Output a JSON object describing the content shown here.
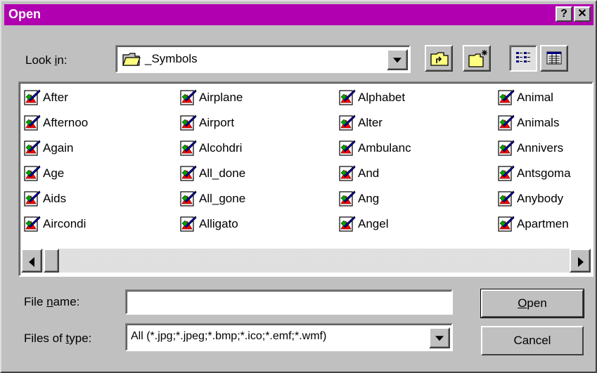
{
  "window": {
    "title": "Open",
    "help_label": "?",
    "close_label": "✕"
  },
  "lookin": {
    "label_pre": "Look ",
    "label_key": "i",
    "label_post": "n:",
    "value": "_Symbols"
  },
  "files": [
    [
      "After",
      "Afternoo",
      "Again",
      "Age",
      "Aids",
      "Aircondi"
    ],
    [
      "Airplane",
      "Airport",
      "Alcohdri",
      "All_done",
      "All_gone",
      "Alligato"
    ],
    [
      "Alphabet",
      "Alter",
      "Ambulanc",
      "And",
      "Ang",
      "Angel"
    ],
    [
      "Animal",
      "Animals",
      "Annivers",
      "Antsgoma",
      "Anybody",
      "Apartmen"
    ]
  ],
  "filename": {
    "label_pre": "File ",
    "label_key": "n",
    "label_post": "ame:",
    "value": ""
  },
  "filetype": {
    "label_pre": "Files of ",
    "label_key": "t",
    "label_post": "ype:",
    "value": "All (*.jpg;*.jpeg;*.bmp;*.ico;*.emf;*.wmf)"
  },
  "buttons": {
    "open_key": "O",
    "open_rest": "pen",
    "cancel": "Cancel"
  },
  "colors": {
    "titlebar": "#b000b0",
    "face": "#c0c0c0"
  },
  "icons": {
    "file": "picture-file-icon",
    "folder": "folder-icon"
  }
}
